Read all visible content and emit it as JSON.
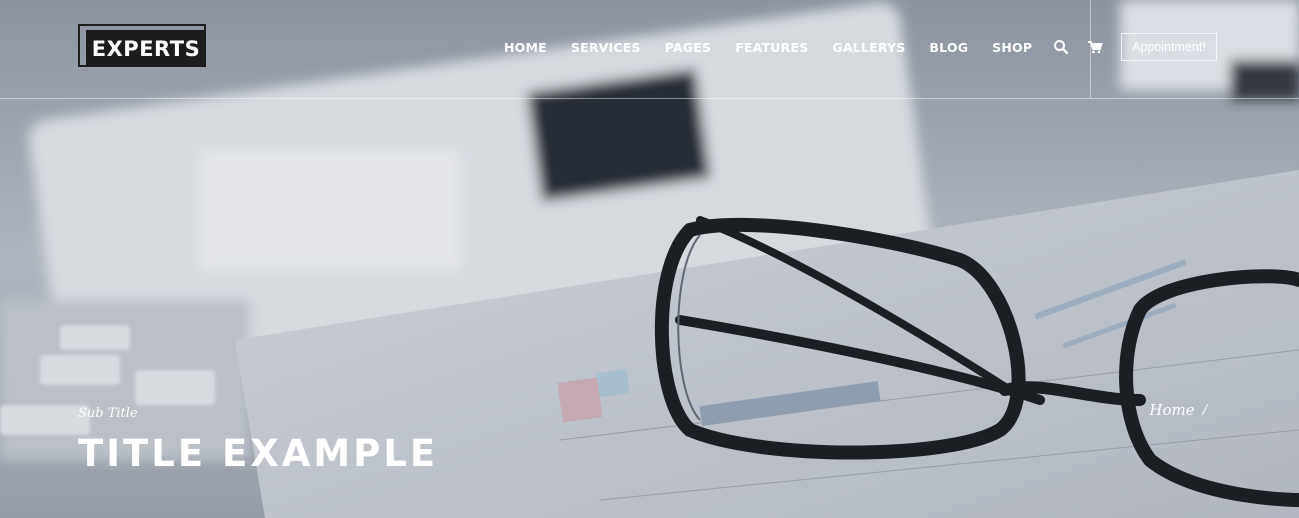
{
  "brand": {
    "logo_text": "EXPERTS"
  },
  "nav": {
    "items": [
      {
        "label": "HOME"
      },
      {
        "label": "SERVICES"
      },
      {
        "label": "PAGES"
      },
      {
        "label": "FEATURES"
      },
      {
        "label": "GALLERYS"
      },
      {
        "label": "BLOG"
      },
      {
        "label": "SHOP"
      }
    ],
    "icons": [
      "search-icon",
      "cart-icon"
    ]
  },
  "cta": {
    "appointment_label": "Appointment!"
  },
  "hero": {
    "subtitle": "Sub Title",
    "title": "TITLE EXAMPLE",
    "breadcrumb": {
      "home": "Home",
      "separator": "/"
    }
  },
  "colors": {
    "overlay": "#aeb3ba",
    "text": "#ffffff",
    "dark": "#1c1c1c"
  }
}
